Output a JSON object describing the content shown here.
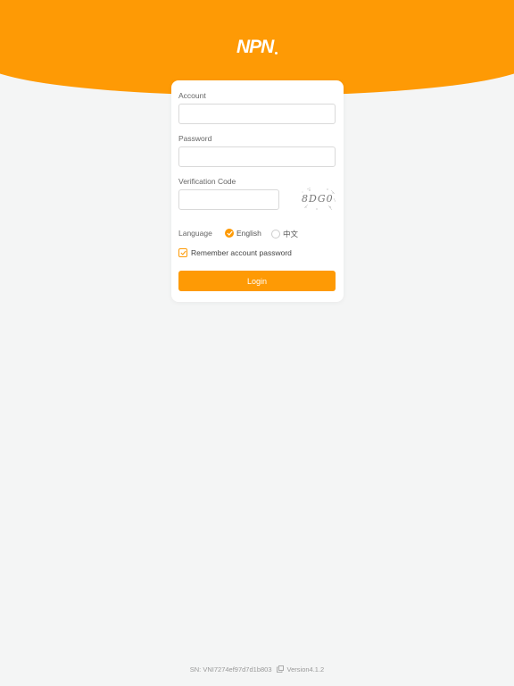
{
  "colors": {
    "brand": "#fe9a05",
    "background": "#f4f5f5"
  },
  "header": {
    "logo_text": "NPN"
  },
  "login_form": {
    "account": {
      "label": "Account",
      "value": "",
      "placeholder": ""
    },
    "password": {
      "label": "Password",
      "value": "",
      "placeholder": ""
    },
    "verification": {
      "label": "Verification Code",
      "value": "",
      "placeholder": "",
      "captcha_text": "8DG0"
    },
    "language": {
      "label": "Language",
      "options": [
        {
          "label": "English",
          "selected": true
        },
        {
          "label": "中文",
          "selected": false
        }
      ]
    },
    "remember": {
      "label": "Remember account password",
      "checked": true
    },
    "login_button": {
      "label": "Login"
    }
  },
  "footer": {
    "sn": "SN: VNI7274ef97d7d1b803",
    "copy_icon": "copy-icon",
    "version": "Version4.1.2"
  }
}
